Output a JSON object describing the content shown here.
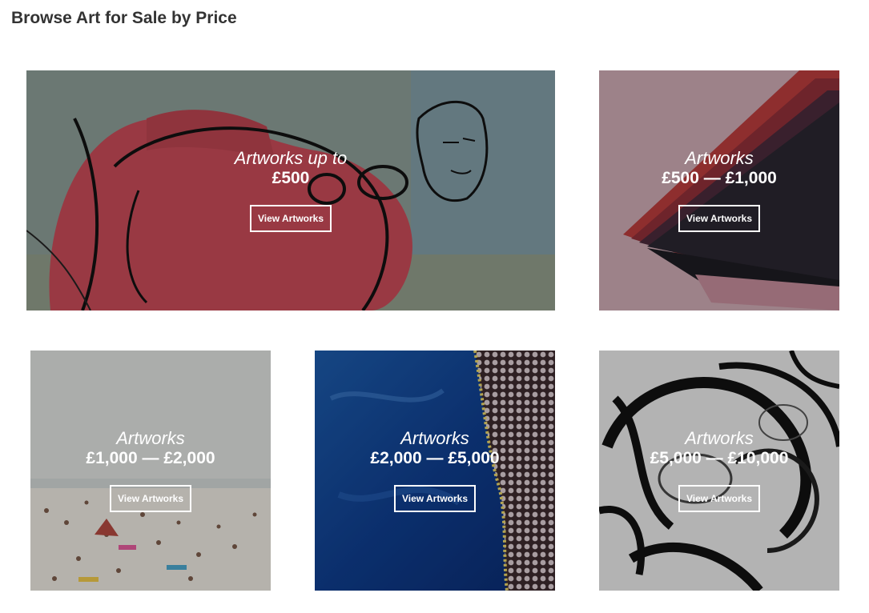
{
  "page": {
    "title": "Browse Art for Sale by Price"
  },
  "cards": [
    {
      "line1": "Artworks up to",
      "line2": "£500",
      "button": "View Artworks"
    },
    {
      "line1": "Artworks",
      "line2": "£500 — £1,000",
      "button": "View Artworks"
    },
    {
      "line1": "Artworks",
      "line2": "£1,000 — £2,000",
      "button": "View Artworks"
    },
    {
      "line1": "Artworks",
      "line2": "£2,000 — £5,000",
      "button": "View Artworks"
    },
    {
      "line1": "Artworks",
      "line2": "£5,000 — £10,000",
      "button": "View Artworks"
    }
  ]
}
